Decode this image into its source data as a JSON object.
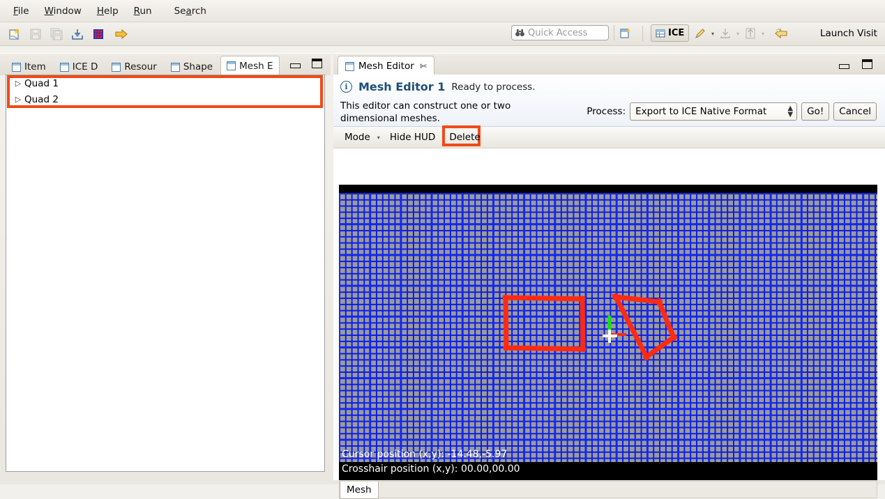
{
  "menubar": {
    "items": [
      {
        "label": "File",
        "mnemonic": "F"
      },
      {
        "label": "Window",
        "mnemonic": "W"
      },
      {
        "label": "Help",
        "mnemonic": "H"
      },
      {
        "label": "Run",
        "mnemonic": "R"
      },
      {
        "label": "Search",
        "mnemonic": "a"
      }
    ]
  },
  "toolbar": {
    "icons": [
      {
        "name": "new-file-icon",
        "enabled": true
      },
      {
        "name": "save-icon",
        "enabled": false
      },
      {
        "name": "save-all-icon",
        "enabled": false
      },
      {
        "name": "import-icon",
        "enabled": true
      },
      {
        "name": "mesh-grid-icon",
        "enabled": true
      },
      {
        "name": "run-arrow-icon",
        "enabled": true
      }
    ],
    "quick_access_placeholder": "Quick Access",
    "quick_access_value": "",
    "perspective_button": "ICE",
    "launch_label": "Launch Visit"
  },
  "left_panel": {
    "tabs": [
      {
        "label": "Item",
        "active": false
      },
      {
        "label": "ICE D",
        "active": false
      },
      {
        "label": "Resour",
        "active": false
      },
      {
        "label": "Shape",
        "active": false
      },
      {
        "label": "Mesh E",
        "active": true
      }
    ],
    "tree_items": [
      {
        "label": "Quad 1"
      },
      {
        "label": "Quad 2"
      }
    ],
    "selection_highlight_color": "#f04a18"
  },
  "editor": {
    "tab_label": "Mesh Editor",
    "title": "Mesh Editor 1",
    "status": "Ready to process.",
    "description": "This editor can construct one or two dimensional meshes.",
    "process_label": "Process:",
    "process_value": "Export to ICE Native Format",
    "go_label": "Go!",
    "cancel_label": "Cancel",
    "mode_label": "Mode",
    "hide_hud_label": "Hide HUD",
    "delete_label": "Delete",
    "delete_highlight_color": "#f04a18",
    "bottom_tab_label": "Mesh"
  },
  "canvas": {
    "hud_cursor": "Cursor position (x,y): -14.48,-5.97",
    "hud_crosshair": "Crosshair position (x,y): 00.00,00.00",
    "grid_color": "#1228f0",
    "grid_bg": "#9b9b9b",
    "shape_color": "#ff2a12",
    "axis_up_color": "#14e014",
    "axis_right_color": "#ff2a12"
  }
}
